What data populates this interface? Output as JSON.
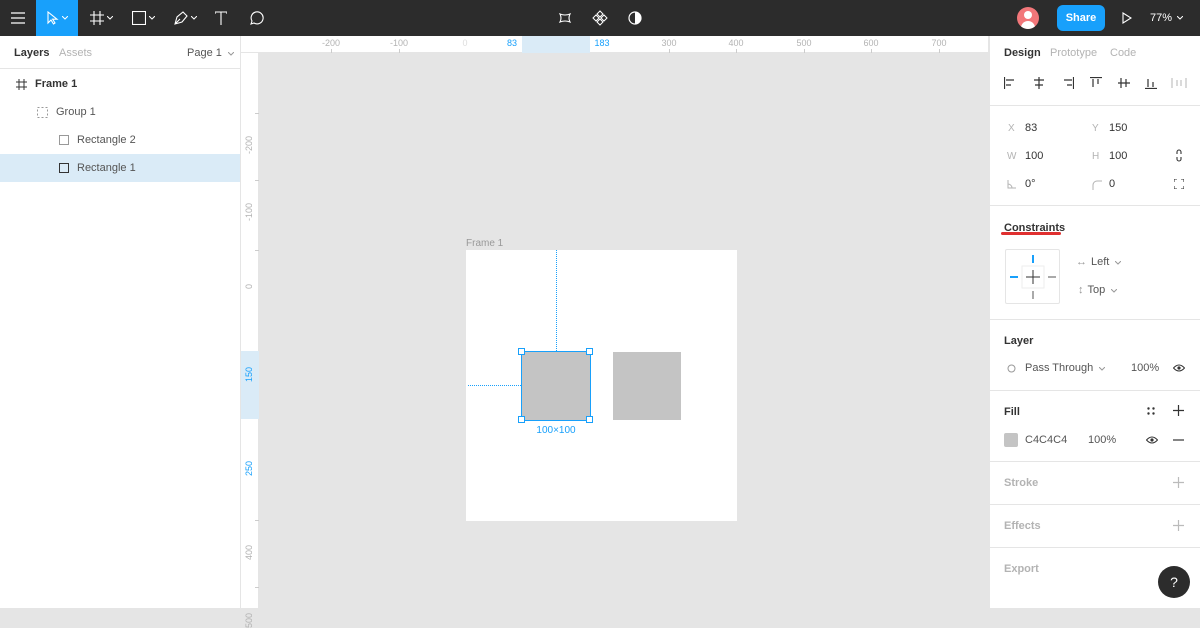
{
  "toolbar": {
    "share_label": "Share",
    "zoom": "77%"
  },
  "layers_panel": {
    "tabs": {
      "layers": "Layers",
      "assets": "Assets"
    },
    "page_select": "Page 1",
    "layers": [
      {
        "name": "Frame 1",
        "type": "frame"
      },
      {
        "name": "Group 1",
        "type": "group"
      },
      {
        "name": "Rectangle 2",
        "type": "rect"
      },
      {
        "name": "Rectangle 1",
        "type": "rect",
        "selected": true
      }
    ]
  },
  "rulers": {
    "top": [
      "-200",
      "-100",
      "0",
      "83",
      "183",
      "300",
      "400",
      "500",
      "600",
      "700"
    ],
    "left": [
      "-200",
      "-100",
      "0",
      "150",
      "250",
      "400",
      "500"
    ]
  },
  "canvas": {
    "frame_label": "Frame 1",
    "selection_size": "100×100"
  },
  "design_panel": {
    "tabs": {
      "design": "Design",
      "prototype": "Prototype",
      "code": "Code"
    },
    "props": {
      "x_label": "X",
      "x": "83",
      "y_label": "Y",
      "y": "150",
      "w_label": "W",
      "w": "100",
      "h_label": "H",
      "h": "100",
      "rotation": "0°",
      "radius": "0"
    },
    "constraints": {
      "title": "Constraints",
      "horizontal": "Left",
      "vertical": "Top"
    },
    "layer": {
      "title": "Layer",
      "blend": "Pass Through",
      "opacity": "100%"
    },
    "fill": {
      "title": "Fill",
      "color_hex": "C4C4C4",
      "opacity": "100%"
    },
    "stroke": {
      "title": "Stroke"
    },
    "effects": {
      "title": "Effects"
    },
    "export": {
      "title": "Export"
    }
  },
  "colors": {
    "accent": "#18a0fb",
    "fill": "#c4c4c4",
    "toolbar": "#2c2c2c"
  },
  "help_label": "?"
}
